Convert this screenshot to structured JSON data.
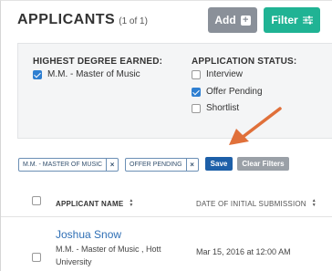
{
  "header": {
    "title": "APPLICANTS",
    "count": "(1 of 1)",
    "add_label": "Add",
    "filter_label": "Filter"
  },
  "filters": {
    "degree": {
      "title": "HIGHEST DEGREE EARNED:",
      "options": [
        {
          "label": "M.M. - Master of Music",
          "checked": true
        }
      ]
    },
    "status": {
      "title": "APPLICATION STATUS:",
      "options": [
        {
          "label": "Interview",
          "checked": false
        },
        {
          "label": "Offer Pending",
          "checked": true
        },
        {
          "label": "Shortlist",
          "checked": false
        }
      ]
    }
  },
  "active_filters": {
    "chips": [
      {
        "label": "M.M. - MASTER OF MUSIC"
      },
      {
        "label": "OFFER PENDING"
      }
    ],
    "remove_glyph": "×",
    "save_label": "Save",
    "clear_label": "Clear Filters"
  },
  "table": {
    "columns": [
      "APPLICANT NAME",
      "DATE OF INITIAL SUBMISSION"
    ],
    "rows": [
      {
        "name": "Joshua Snow",
        "detail": "M.M. - Master of Music , Hott University",
        "date": "Mar 15, 2016 at 12:00 AM"
      }
    ]
  },
  "colors": {
    "accent_green": "#20b394",
    "save_blue": "#1d5fa8",
    "arrow_orange": "#e0703a",
    "link_blue": "#2f6fb5"
  },
  "icons": {
    "add": "plus-square-icon",
    "filter": "sliders-icon",
    "sort": "sort-icon",
    "annotation": "pointer-arrow-icon"
  }
}
